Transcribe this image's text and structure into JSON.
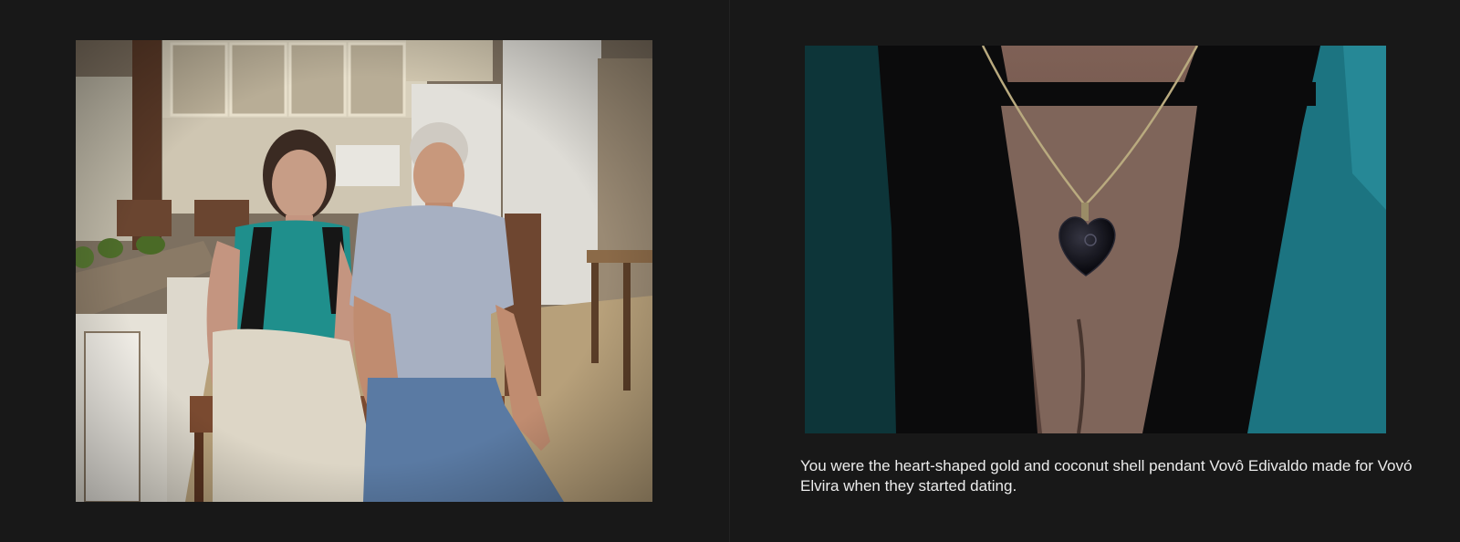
{
  "story": {
    "left_photo": {
      "subject": "kitchen-portrait-photo"
    },
    "right_photo": {
      "subject": "heart-pendant-photo",
      "caption": "You were the heart-shaped gold and coconut shell pendant Vovô Edivaldo made for Vovó Elvira when they started dating."
    }
  },
  "colors": {
    "background": "#181818",
    "caption_text": "#ececec"
  }
}
